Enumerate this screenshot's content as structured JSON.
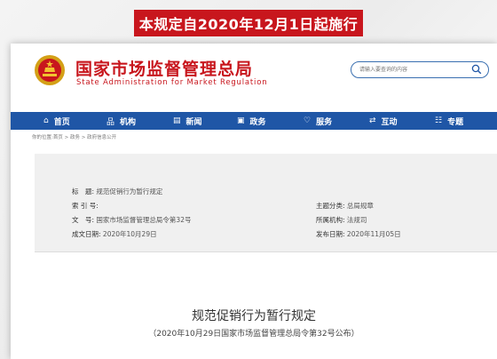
{
  "banner": "本规定自2020年12月1日起施行",
  "site": {
    "title": "国家市场监督管理总局",
    "subtitle": "State Administration for Market Regulation"
  },
  "search": {
    "placeholder": "请输入要查询的内容"
  },
  "nav": [
    {
      "icon": "home-icon",
      "glyph": "⌂",
      "label": "首页"
    },
    {
      "icon": "org-icon",
      "glyph": "品",
      "label": "机构"
    },
    {
      "icon": "news-icon",
      "glyph": "▤",
      "label": "新闻"
    },
    {
      "icon": "affairs-icon",
      "glyph": "▣",
      "label": "政务"
    },
    {
      "icon": "service-icon",
      "glyph": "♡",
      "label": "服务"
    },
    {
      "icon": "interact-icon",
      "glyph": "⇄",
      "label": "互动"
    },
    {
      "icon": "topic-icon",
      "glyph": "☷",
      "label": "专题"
    }
  ],
  "breadcrumb": "你的位置:首页 > 政务 > 政府信息公开",
  "meta": {
    "title_label": "标　题:",
    "title_value": "规范促销行为暂行规定",
    "index_label": "索 引 号:",
    "index_value": "",
    "topic_label": "主题分类:",
    "topic_value": "总局规章",
    "docno_label": "文　号:",
    "docno_value": "国家市场监督管理总局令第32号",
    "org_label": "所属机构:",
    "org_value": "法规司",
    "date_label": "成文日期:",
    "date_value": "2020年10月29日",
    "pub_label": "发布日期:",
    "pub_value": "2020年11月05日"
  },
  "document": {
    "title": "规范促销行为暂行规定",
    "subtitle": "（2020年10月29日国家市场监督管理总局令第32号公布）"
  },
  "colors": {
    "brand_red": "#c8161d",
    "nav_blue": "#1f56a6"
  }
}
